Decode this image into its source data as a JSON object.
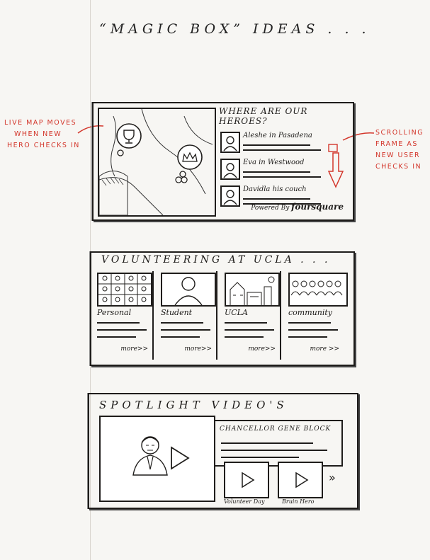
{
  "title": "“MAGIC BOX” IDEAS . . .",
  "annotations": {
    "left": [
      "LIVE MAP MOVES",
      "WHEN NEW",
      "HERO CHECKS IN"
    ],
    "right": [
      "SCROLLING",
      "FRAME AS",
      "NEW USER",
      "CHECKS IN"
    ]
  },
  "heroes": {
    "title": "WHERE ARE OUR HEROES?",
    "items": [
      {
        "label": "Aleshe in Pasadena"
      },
      {
        "label": "Eva in Westwood"
      },
      {
        "label": "Davidla his couch"
      }
    ],
    "powered_prefix": "Powered By",
    "powered_brand": "foursquare"
  },
  "volunteering": {
    "title": "VOLUNTEERING AT UCLA . . .",
    "cards": [
      {
        "label": "Personal",
        "more": "more>>"
      },
      {
        "label": "Student",
        "more": "more>>"
      },
      {
        "label": "UCLA",
        "more": "more>>"
      },
      {
        "label": "community",
        "more": "more >>"
      }
    ]
  },
  "spotlight": {
    "title": "SPOTLIGHT VIDEO'S",
    "feature_title": "CHANCELLOR GENE BLOCK",
    "thumbs": [
      {
        "label": "Volunteer Day"
      },
      {
        "label": "Bruin Hero"
      }
    ],
    "next": "»"
  },
  "colors": {
    "ink": "#1f1d1b",
    "annotation": "#d3362b",
    "paper": "#f7f6f3"
  }
}
